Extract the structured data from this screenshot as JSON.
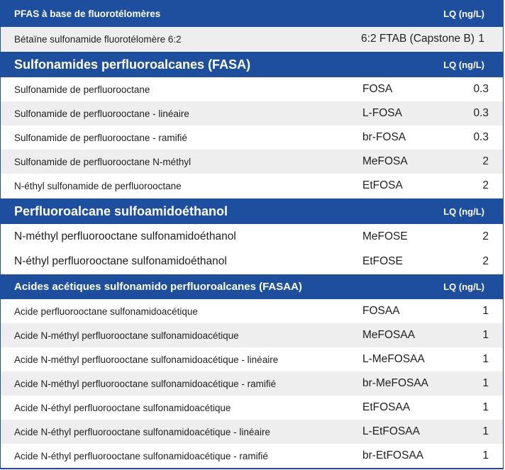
{
  "sections": [
    {
      "title": "PFAS à base de fluorotélomères",
      "lq": "LQ (ng/L)",
      "rows": [
        {
          "name": "Bétaïne sulfonamide fluorotélomère 6:2",
          "abbr": "6:2 FTAB (Capstone B)",
          "val": "1"
        }
      ]
    },
    {
      "title": "Sulfonamides perfluoroalcanes (FASA)",
      "lq": "LQ (ng/L)",
      "rows": [
        {
          "name": "Sulfonamide de perfluorooctane",
          "abbr": "FOSA",
          "val": "0.3"
        },
        {
          "name": "Sulfonamide de perfluorooctane - linéaire",
          "abbr": "L-FOSA",
          "val": "0.3"
        },
        {
          "name": "Sulfonamide de perfluorooctane - ramifié",
          "abbr": "br-FOSA",
          "val": "0.3"
        },
        {
          "name": "Sulfonamide de perfluorooctane N-méthyl",
          "abbr": "MeFOSA",
          "val": "2"
        },
        {
          "name": "N-éthyl sulfonamide de perfluorooctane",
          "abbr": "EtFOSA",
          "val": "2"
        }
      ]
    },
    {
      "title": "Perfluoroalcane sulfoamidoéthanol",
      "lq": "LQ (ng/L)",
      "rows": [
        {
          "name": "N-méthyl perfluorooctane sulfonamidoéthanol",
          "abbr": "MeFOSE",
          "val": "2"
        },
        {
          "name": "N-éthyl perfluorooctane sulfonamidoéthanol",
          "abbr": "EtFOSE",
          "val": "2"
        }
      ]
    },
    {
      "title": "Acides acétiques sulfonamido perfluoroalcanes (FASAA)",
      "lq": "LQ (ng/L)",
      "rows": [
        {
          "name": "Acide perfluorooctane sulfonamidoacétique",
          "abbr": "FOSAA",
          "val": "1"
        },
        {
          "name": "Acide N-méthyl perfluorooctane sulfonamidoacétique",
          "abbr": "MeFOSAA",
          "val": "1"
        },
        {
          "name": "Acide N-méthyl perfluorooctane sulfonamidoacétique - linéaire",
          "abbr": "L-MeFOSAA",
          "val": "1"
        },
        {
          "name": "Acide N-méthyl perfluorooctane sulfonamidoacétique - ramifié",
          "abbr": "br-MeFOSAA",
          "val": "1"
        },
        {
          "name": "Acide N-éthyl perfluorooctane sulfonamidoacétique",
          "abbr": "EtFOSAA",
          "val": "1"
        },
        {
          "name": "Acide N-éthyl perfluorooctane sulfonamidoacétique - linéaire",
          "abbr": "L-EtFOSAA",
          "val": "1"
        },
        {
          "name": "Acide N-éthyl perfluorooctane sulfonamidoacétique - ramifié",
          "abbr": "br-EtFOSAA",
          "val": "1"
        }
      ]
    }
  ]
}
